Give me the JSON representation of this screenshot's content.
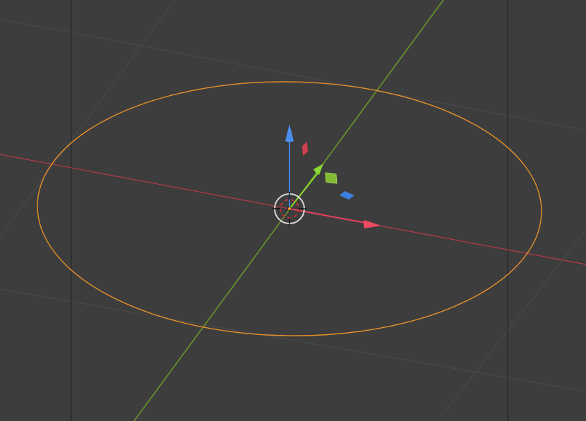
{
  "viewport": {
    "background": "#3d3d3d",
    "grid_color": "#4a4a4a",
    "frame_line_color": "#2a2a2a"
  },
  "axes": {
    "x_color": "#c0394b",
    "y_color": "#6e9a2c"
  },
  "selection": {
    "object_type": "circle",
    "outline_color": "#e8902a"
  },
  "gizmo": {
    "type": "translate",
    "x_arrow_color": "#e8415a",
    "y_arrow_color": "#8bd632",
    "z_arrow_color": "#3d82e0",
    "plane_xy_color": "#3d82e0",
    "plane_xz_color": "#8bd632",
    "plane_yz_color": "#e8415a",
    "pivot_icon": "object-origin-icon",
    "cursor_icon": "3d-cursor-icon"
  }
}
